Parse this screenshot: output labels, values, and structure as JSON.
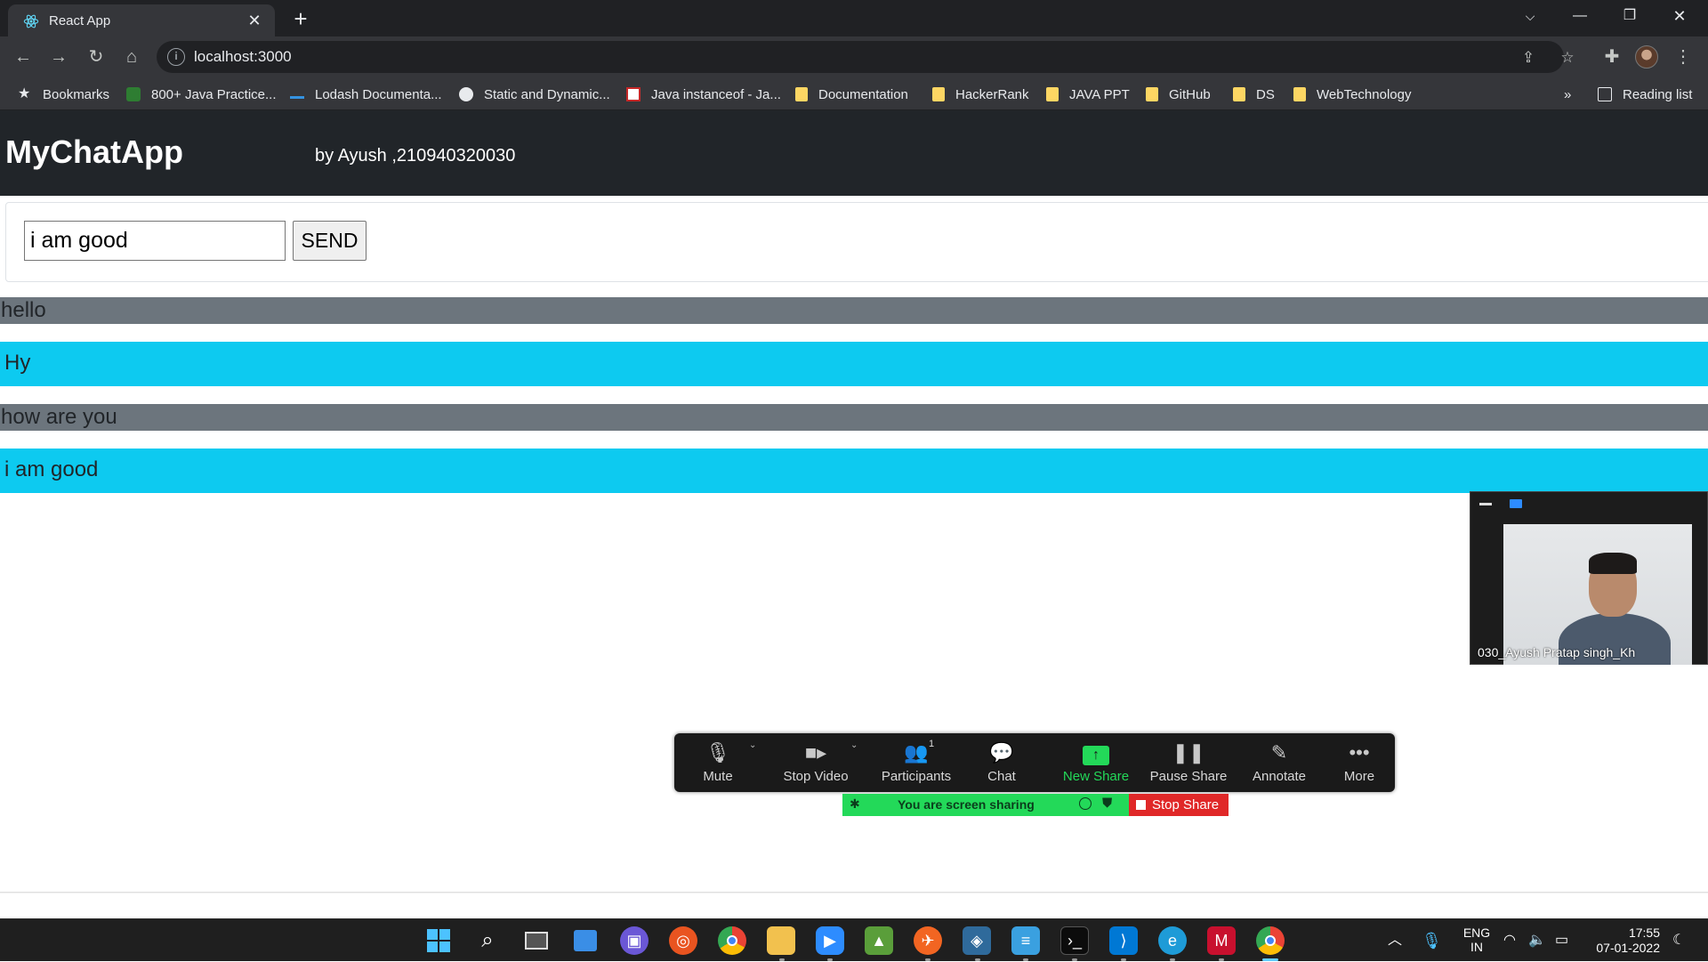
{
  "browser": {
    "tab_title": "React App",
    "url": "localhost:3000",
    "bookmarks": [
      "Bookmarks",
      "800+ Java Practice...",
      "Lodash Documenta...",
      "Static and Dynamic...",
      "Java instanceof - Ja...",
      "Documentation",
      "HackerRank",
      "JAVA PPT",
      "GitHub",
      "DS",
      "WebTechnology"
    ],
    "reading_list": "Reading list",
    "overflow": "»"
  },
  "app": {
    "brand": "MyChatApp",
    "byline": "by Ayush ,210940320030",
    "input_value": "i am good",
    "send_label": "SEND",
    "messages": [
      {
        "text": "hello",
        "kind": "received"
      },
      {
        "text": "Hy",
        "kind": "sent"
      },
      {
        "text": "how are you",
        "kind": "received"
      },
      {
        "text": "i am good",
        "kind": "sent"
      }
    ],
    "colors": {
      "navbar": "#212529",
      "sent": "#0dcaf0",
      "received": "#6c757d"
    }
  },
  "zoom": {
    "participant_name": "030_Ayush Pratap singh_Kh",
    "toolbar": {
      "mute": "Mute",
      "stop_video": "Stop Video",
      "participants": "Participants",
      "participants_count": "1",
      "chat": "Chat",
      "new_share": "New Share",
      "pause_share": "Pause Share",
      "annotate": "Annotate",
      "more": "More"
    },
    "sharing_status": "You are screen sharing",
    "stop_share": "Stop Share"
  },
  "taskbar": {
    "language": "ENG",
    "region": "IN",
    "time": "17:55",
    "date": "07-01-2022"
  }
}
